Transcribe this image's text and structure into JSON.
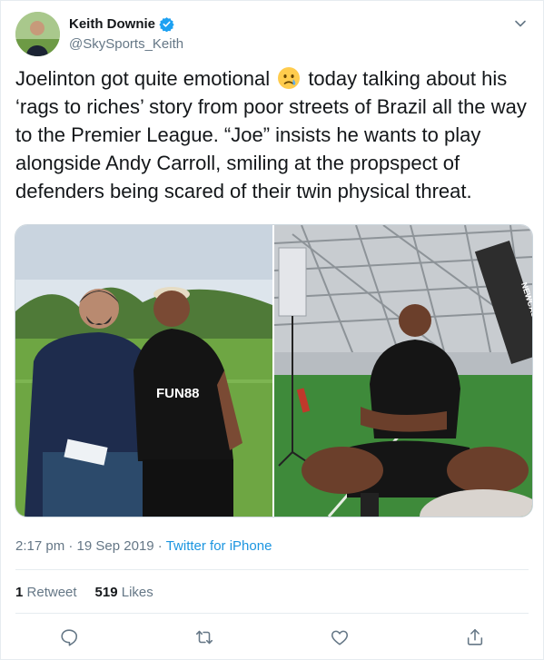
{
  "author": {
    "display_name": "Keith Downie",
    "handle": "@SkySports_Keith",
    "verified": true
  },
  "tweet": {
    "text_before_emoji": "Joelinton got quite emotional ",
    "emoji": "crying-face",
    "text_after_emoji": " today talking about his\n‘rags to riches’ story from poor streets of Brazil all the way\nto the Premier League. “Joe” insists he wants to play\nalongside Andy Carroll, smiling at the propspect of\ndefenders being scared of their twin physical threat."
  },
  "media": {
    "photos": [
      {
        "kind": "photo",
        "subject": "two-men-on-training-pitch"
      },
      {
        "kind": "photo",
        "subject": "player-seated-interview-indoor-pitch"
      }
    ],
    "shirt_sponsor": "FUN88",
    "banner_text": "NEWCASTLE"
  },
  "meta": {
    "time": "2:17 pm",
    "date": "19 Sep 2019",
    "separator": " · ",
    "source": "Twitter for iPhone"
  },
  "stats": {
    "retweets_count": "1",
    "retweets_label": "Retweet",
    "likes_count": "519",
    "likes_label": "Likes"
  },
  "actions": [
    "reply-icon",
    "retweet-icon",
    "like-icon",
    "share-icon"
  ],
  "colors": {
    "text": "#14171a",
    "secondary": "#657786",
    "link": "#1b95e0",
    "border": "#e6ecf0",
    "verified": "#1da1f2"
  }
}
